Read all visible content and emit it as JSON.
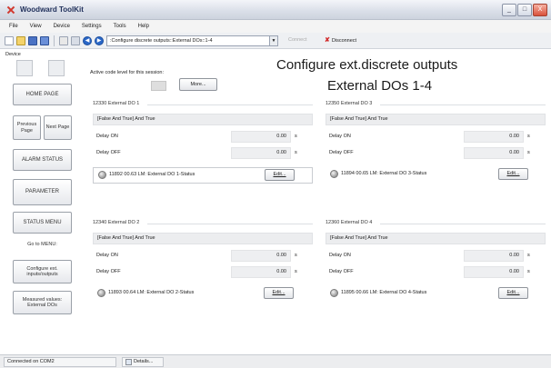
{
  "window": {
    "title": "Woodward ToolKit",
    "buttons": {
      "minimize": "_",
      "maximize": "□",
      "close": "X"
    }
  },
  "menu": [
    "File",
    "View",
    "Device",
    "Settings",
    "Tools",
    "Help"
  ],
  "toolbar": {
    "icons": [
      "new-icon",
      "open-icon",
      "save-icon",
      "save-all-icon",
      "properties-icon",
      "settings-icon"
    ],
    "back_label": "◀",
    "forward_label": "▶",
    "page_select": ":Configure discrete outputs::External DOs::1-4",
    "connect_label": "Connect",
    "disconnect_label": "Disconnect"
  },
  "sidebar": {
    "device_label": "Device",
    "home": "HOME PAGE",
    "previous": "Previous Page",
    "next": "Next Page",
    "alarm": "ALARM STATUS",
    "parameter": "PARAMETER",
    "status_menu": "STATUS MENU",
    "goto_label": "Go to MENU:",
    "configure": "Configure ext. inputs/outputs",
    "measured": "Measured values: External DOs"
  },
  "header": {
    "title_line1": "Configure ext.discrete outputs",
    "title_line2": "External DOs  1-4"
  },
  "session": {
    "label": "Active code level for this session:",
    "more_label": "More..."
  },
  "groups": [
    {
      "title": "12330 External DO 1",
      "logic": "[False And True] And True",
      "delay_on_label": "Delay ON",
      "delay_on_value": "0.00",
      "delay_off_label": "Delay OFF",
      "delay_off_value": "0.00",
      "unit": "s",
      "status": "11892 00.63 LM:  External DO 1-Status",
      "edit_label": "Edit..."
    },
    {
      "title": "12350 External DO 3",
      "logic": "[False And True] And True",
      "delay_on_label": "Delay ON",
      "delay_on_value": "0.00",
      "delay_off_label": "Delay OFF",
      "delay_off_value": "0.00",
      "unit": "s",
      "status": "11894 00.65 LM:  External DO 3-Status",
      "edit_label": "Edit..."
    },
    {
      "title": "12340 External DO 2",
      "logic": "[False And True] And True",
      "delay_on_label": "Delay ON",
      "delay_on_value": "0.00",
      "delay_off_label": "Delay OFF",
      "delay_off_value": "0.00",
      "unit": "s",
      "status": "11893 00.64 LM:  External DO 2-Status",
      "edit_label": "Edit..."
    },
    {
      "title": "12360 External DO 4",
      "logic": "[False And True] And True",
      "delay_on_label": "Delay ON",
      "delay_on_value": "0.00",
      "delay_off_label": "Delay OFF",
      "delay_off_value": "0.00",
      "unit": "s",
      "status": "11895 00.66 LM:  External DO 4-Status",
      "edit_label": "Edit..."
    }
  ],
  "statusbar": {
    "connection": "Connected on COM2",
    "details": "Details..."
  }
}
